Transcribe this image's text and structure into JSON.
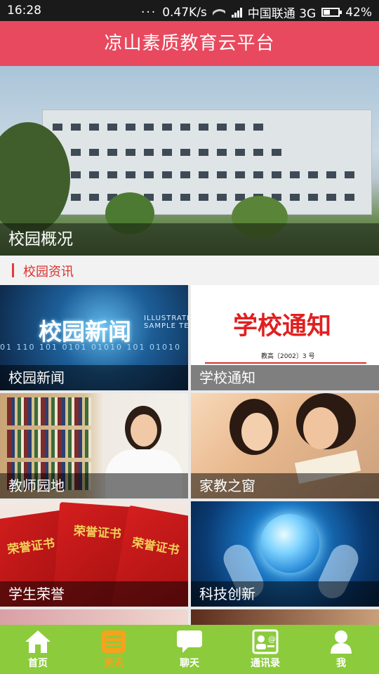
{
  "status_bar": {
    "time": "16:28",
    "speed": "0.47K/s",
    "carrier": "中国联通 3G",
    "battery_percent": "42%",
    "battery_level": 0.42
  },
  "header": {
    "title": "凉山素质教育云平台"
  },
  "banner": {
    "caption": "校园概况"
  },
  "section": {
    "title": "校园资讯"
  },
  "tiles": [
    {
      "label": "校园新闻",
      "image_title": "校园新闻",
      "image_sub": "ILLUSTRATION",
      "image_sub2": "SAMPLE TEXT",
      "image_digits": "01 110 101 0101 01010 101 01010"
    },
    {
      "label": "学校通知",
      "image_title": "学校通知",
      "image_doc": "教高〔2002〕3 号"
    },
    {
      "label": "教师园地"
    },
    {
      "label": "家教之窗"
    },
    {
      "label": "学生荣誉",
      "image_text": "荣誉证书"
    },
    {
      "label": "科技创新"
    }
  ],
  "bottom_nav": {
    "items": [
      {
        "label": "首页",
        "icon": "home-icon"
      },
      {
        "label": "资讯",
        "icon": "news-icon"
      },
      {
        "label": "聊天",
        "icon": "chat-icon"
      },
      {
        "label": "通讯录",
        "icon": "contacts-icon"
      },
      {
        "label": "我",
        "icon": "profile-icon"
      }
    ],
    "active_index": 1,
    "background": "#8ccb3c",
    "active_color": "#f7a21b"
  },
  "colors": {
    "header": "#e8495e",
    "section_accent": "#e33b3b"
  }
}
